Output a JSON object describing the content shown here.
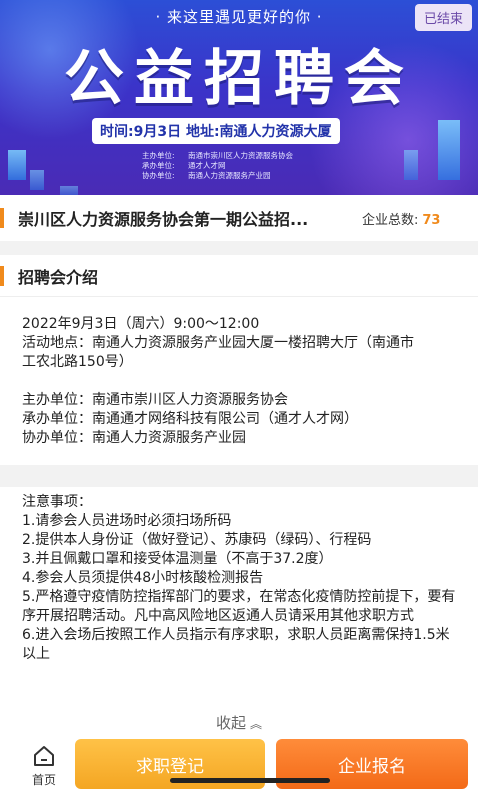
{
  "banner": {
    "slogan": "· 来这里遇见更好的你 ·",
    "status_badge": "已结束",
    "big_title": "公益招聘会",
    "time_location": "时间:9月3日 地址:南通人力资源大厦",
    "organizers": [
      {
        "role": "主办单位:",
        "name": "南通市崇川区人力资源服务协会"
      },
      {
        "role": "承办单位:",
        "name": "通才人才网"
      },
      {
        "role": "协办单位:",
        "name": "南通人力资源服务产业园"
      }
    ]
  },
  "header": {
    "title": "崇川区人力资源服务协会第一期公益招...",
    "company_count_label": "企业总数:",
    "company_count": "73"
  },
  "intro": {
    "section_title": "招聘会介绍",
    "lines": [
      "2022年9月3日（周六）9:00～12:00",
      "活动地点：南通人力资源服务产业园大厦一楼招聘大厅（南通市",
      "工农北路150号）"
    ],
    "hosts": [
      "主办单位：南通市崇川区人力资源服务协会",
      "承办单位：南通通才网络科技有限公司（通才人才网）",
      "协办单位：南通人力资源服务产业园"
    ]
  },
  "notes": {
    "heading": "注意事项：",
    "items": [
      "1.请参会人员进场时必须扫场所码",
      "2.提供本人身份证（做好登记）、苏康码（绿码）、行程码",
      "3.并且佩戴口罩和接受体温测量（不高于37.2度）",
      "4.参会人员须提供48小时核酸检测报告",
      "5.严格遵守疫情防控指挥部门的要求，在常态化疫情防控前提下，要有序开展招聘活动。凡中高风险地区返通人员请采用其他求职方式",
      "6.进入会场后按照工作人员指示有序求职，求职人员距离需保持1.5米以上"
    ],
    "collapse_label": "收起",
    "collapse_icon": "chevron-up-icon"
  },
  "bottom_nav": {
    "home_label": "首页",
    "home_icon": "home-icon",
    "register_button": "求职登记",
    "enroll_button": "企业报名"
  },
  "colors": {
    "accent": "#f08a1c",
    "register_button": "#f4a623",
    "enroll_button": "#f36a18",
    "banner": "#3b33c9"
  }
}
